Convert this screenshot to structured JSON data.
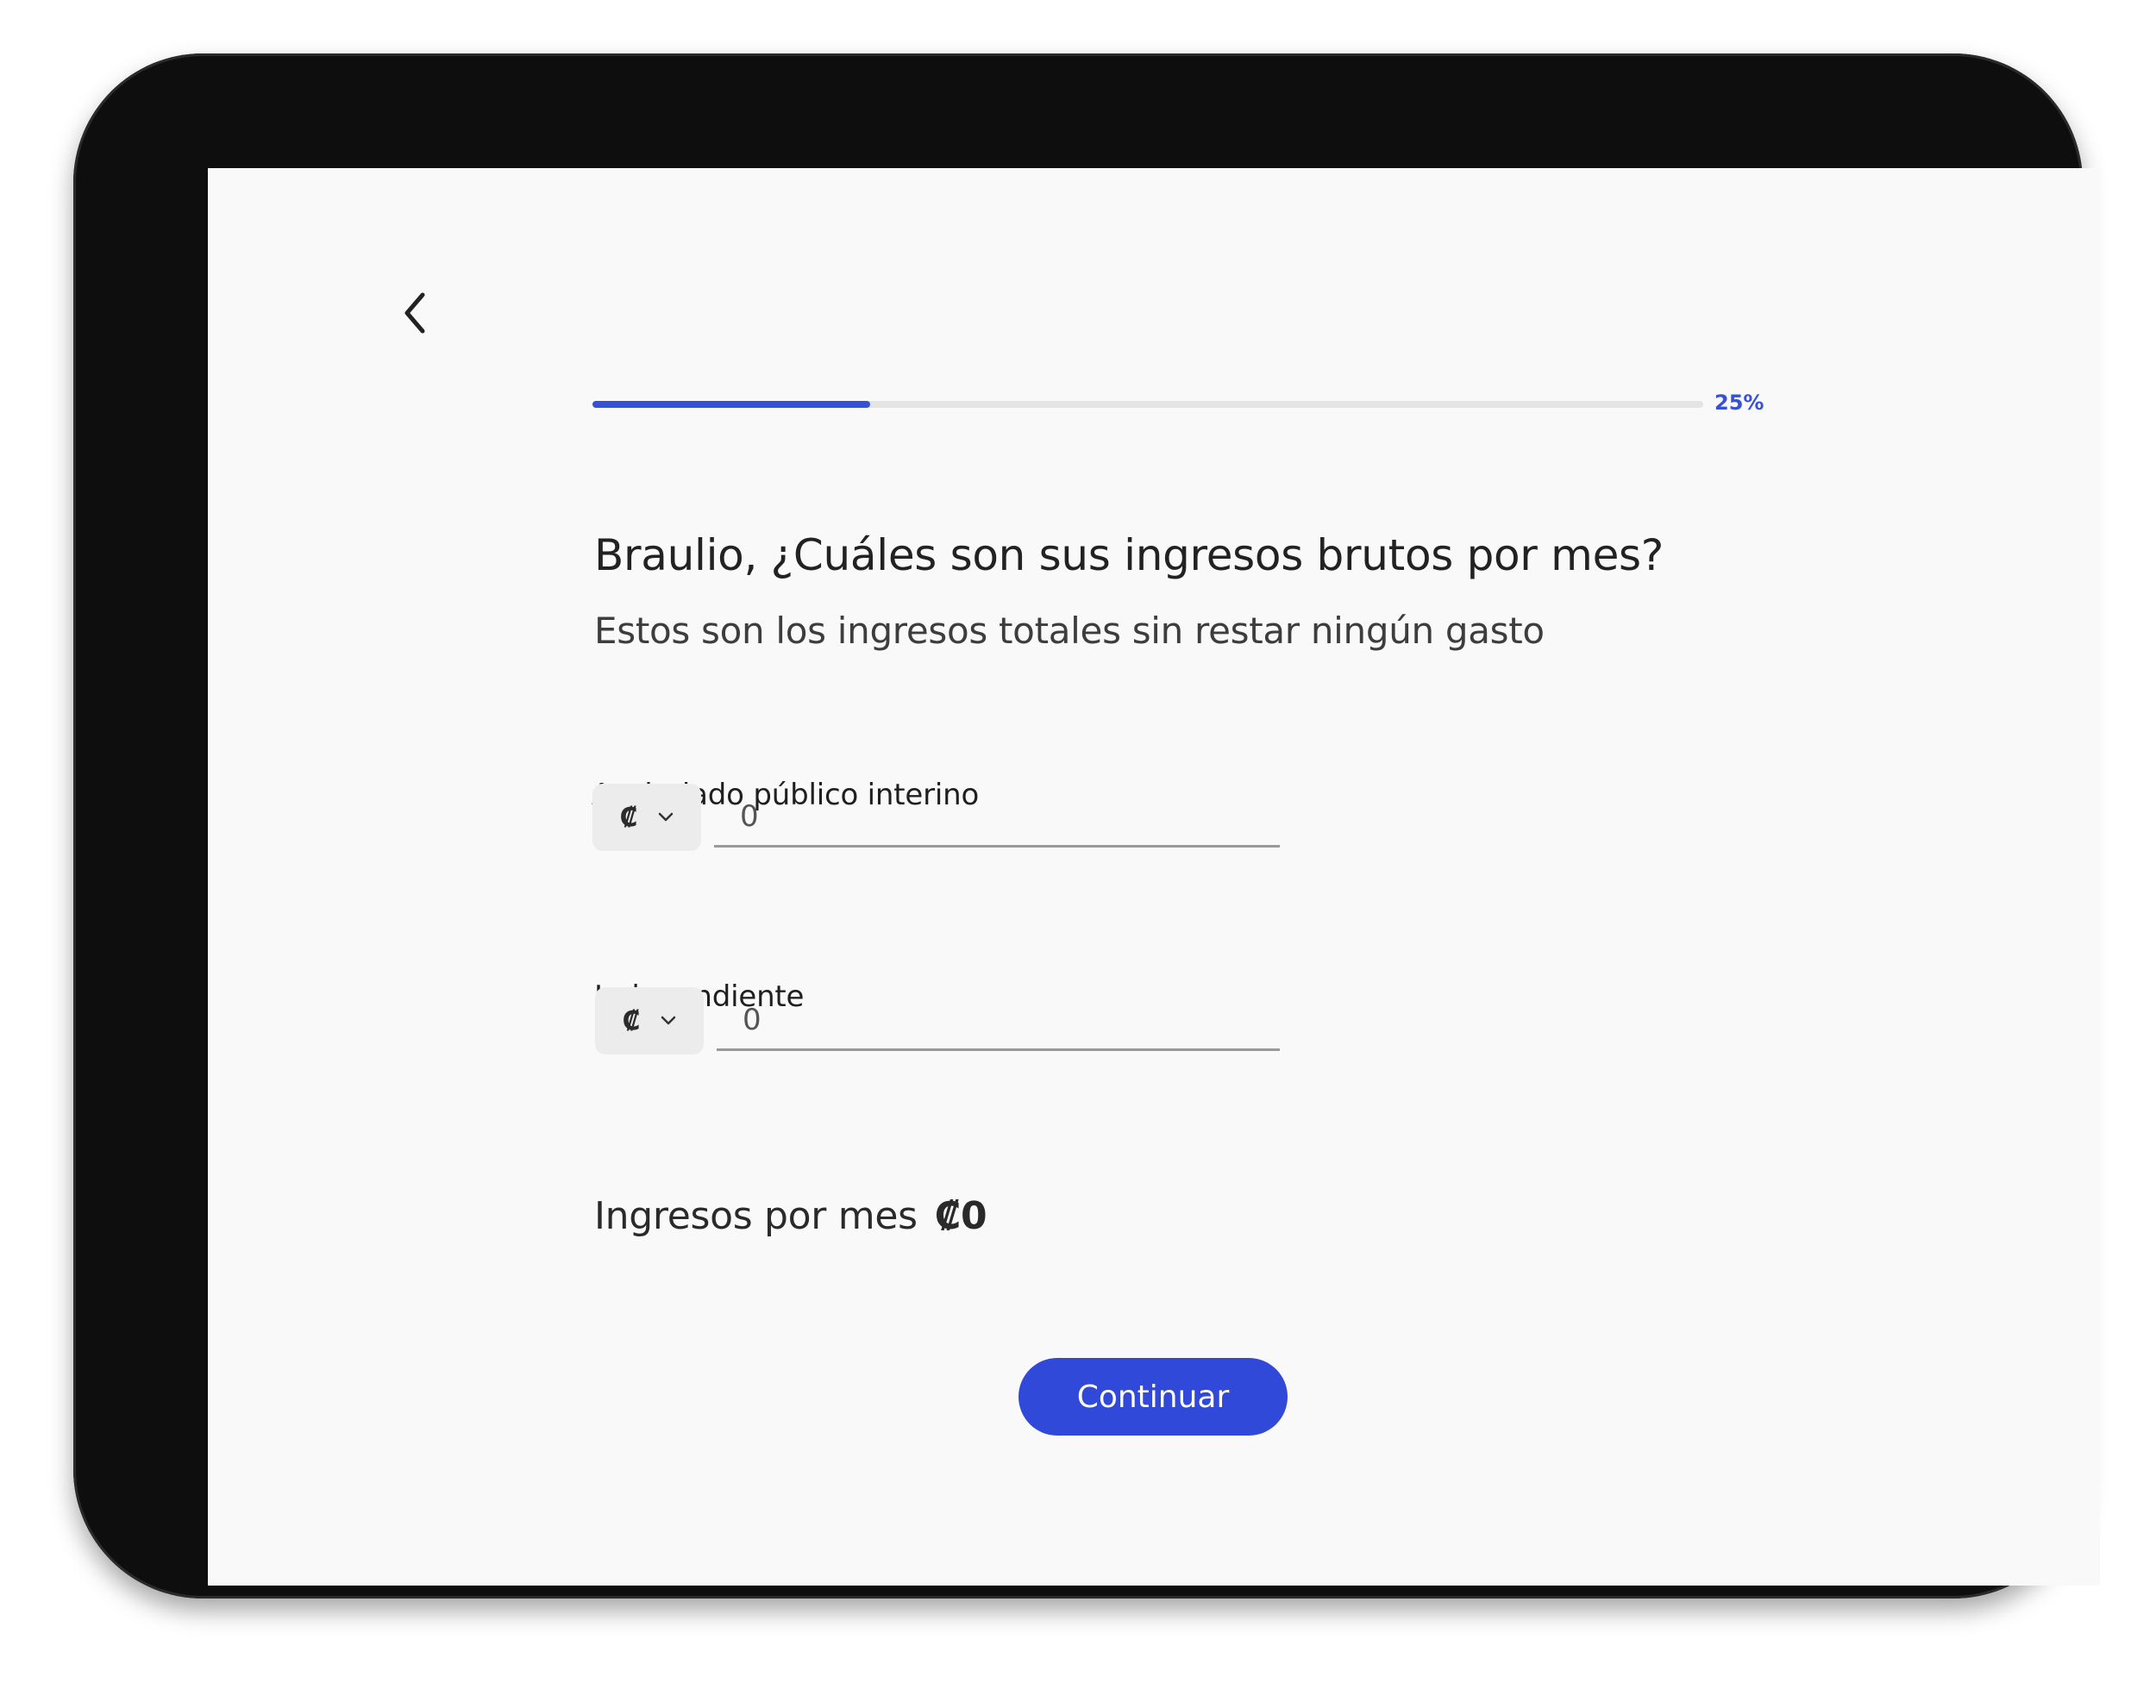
{
  "progress": {
    "percent": 25,
    "label": "25%"
  },
  "question": {
    "title": "Braulio, ¿Cuáles son sus ingresos brutos por mes?",
    "subtitle": "Estos son los ingresos totales sin restar ningún gasto"
  },
  "fields": [
    {
      "label": "Asalariado público interino",
      "currency_symbol": "₡",
      "value": "0"
    },
    {
      "label": "Independiente",
      "currency_symbol": "₡",
      "value": "0"
    }
  ],
  "total": {
    "label": "Ingresos por mes",
    "value": "₡0"
  },
  "actions": {
    "continue_label": "Continuar"
  },
  "icons": {
    "back": "chevron-left-icon",
    "dropdown": "chevron-down-icon"
  },
  "colors": {
    "accent": "#3651d4",
    "button": "#3049d8",
    "track": "#e4e4e4",
    "background": "#f9f9f9"
  }
}
